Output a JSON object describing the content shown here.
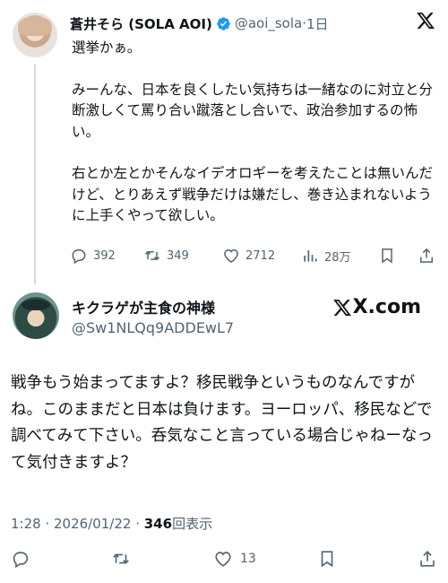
{
  "original_tweet": {
    "display_name": "蒼井そら (SOLA AOI)",
    "handle": "@aoi_sola",
    "separator": "·",
    "time": "1日",
    "paragraphs": [
      "選挙かぁ。",
      "みーんな、日本を良くしたい気持ちは一緒なのに対立と分断激しくて罵り合い蹴落とし合いで、政治参加するの怖い。",
      "右とか左とかそんなイデオロギーを考えたことは無いんだけど、とりあえず戦争だけは嫌だし、巻き込まれないように上手くやって欲しい。"
    ],
    "stats": {
      "replies": "392",
      "retweets": "349",
      "likes": "2712",
      "views": "28万"
    }
  },
  "reply": {
    "display_name": "キクラゲが主食の神様",
    "handle": "@Sw1NLQq9ADDEwL7",
    "brand": "X.com",
    "text": "戦争もう始まってますよ？移民戦争というものなんですがね。このままだと日本は負けます。ヨーロッパ、移民などで調べてみて下さい。呑気なこと言っている場合じゃねーなって気付きますよ？",
    "timestamp": "1:28 · 2026/01/22 · ",
    "views_count": "346",
    "views_label": "回表示",
    "likes": "13"
  },
  "icons": [
    "verified-badge-icon",
    "x-logo-icon",
    "reply-icon",
    "retweet-icon",
    "like-icon",
    "views-icon",
    "bookmark-icon",
    "share-icon"
  ],
  "colors": {
    "text": "#0f1419",
    "secondary": "#536471",
    "verified": "#1d9bf0",
    "line": "#cfd9de"
  }
}
